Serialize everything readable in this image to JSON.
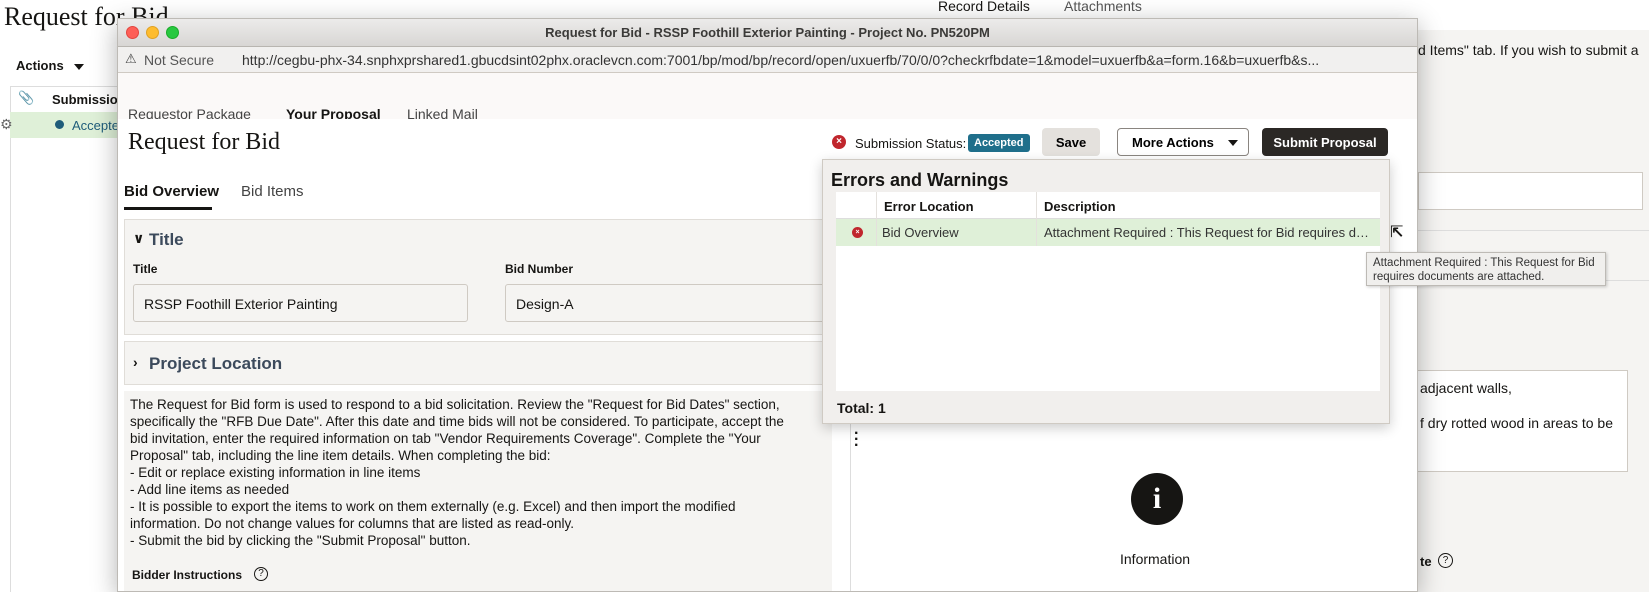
{
  "background": {
    "page_title": "Request for Bid",
    "actions_label": "Actions",
    "submission_col": "Submission",
    "row_status": "Accepte",
    "right_tabs": {
      "record_details": "Record Details",
      "attachments": "Attachments"
    },
    "right_info_1": "d Items\" tab. If you wish to submit a",
    "right_info_2": "",
    "textarea_line1": "adjacent walls,",
    "textarea_line2": "f dry rotted wood in areas to be",
    "date_label": "te",
    "help_glyph": "?"
  },
  "window": {
    "title": "Request for Bid - RSSP Foothill Exterior Painting - Project No. PN520PM",
    "not_secure": "Not Secure",
    "url": "http://cegbu-phx-34.snphxprshared1.gbucdsint02phx.oraclevcn.com:7001/bp/mod/bp/record/open/uxuerfb/70/0/0?checkrfbdate=1&model=uxuerfb&a=form.16&b=uxuerfb&s..."
  },
  "top_tabs": {
    "requestor": "Requestor Package",
    "proposal": "Your Proposal",
    "linked": "Linked Mail"
  },
  "header": {
    "title": "Request for Bid",
    "submission_status_label": "Submission Status:",
    "status_badge": "Accepted",
    "save": "Save",
    "more_actions": "More Actions",
    "submit": "Submit Proposal"
  },
  "sub_tabs": {
    "overview": "Bid Overview",
    "items": "Bid Items"
  },
  "title_section": {
    "heading": "Title",
    "title_label": "Title",
    "title_value": "RSSP Foothill Exterior Painting",
    "bid_number_label": "Bid Number",
    "bid_number_value": "Design-A"
  },
  "location_section": {
    "heading": "Project Location"
  },
  "instructions": {
    "lines": [
      "The Request for Bid form is used to respond to a bid solicitation. Review the \"Request for Bid Dates\" section,",
      "specifically the \"RFB Due Date\". After this date and time bids will not be considered. To participate, accept the",
      "bid invitation, enter the required information on tab \"Vendor Requirements Coverage\". Complete the \"Your",
      "Proposal\" tab, including the line item details. When completing the bid:",
      "- Edit or replace existing information in line items",
      "- Add line items as needed",
      "- It is possible to export the items to work on them externally (e.g. Excel) and then import the modified",
      "information. Do not change values for columns that are listed as read-only.",
      "- Submit the bid by clicking the \"Submit Proposal\" button."
    ],
    "bidder_label": "Bidder Instructions",
    "help_glyph": "?"
  },
  "info_panel": {
    "glyph": "i",
    "label": "Information"
  },
  "errors": {
    "heading": "Errors and Warnings",
    "col_location": "Error Location",
    "col_description": "Description",
    "row_location": "Bid Overview",
    "row_description": "Attachment Required : This Request for Bid requires documents are attached.",
    "total": "Total: 1",
    "error_glyph": "×"
  },
  "tooltip": {
    "line1": "Attachment Required : This Request for Bid",
    "line2": "requires documents are attached."
  }
}
